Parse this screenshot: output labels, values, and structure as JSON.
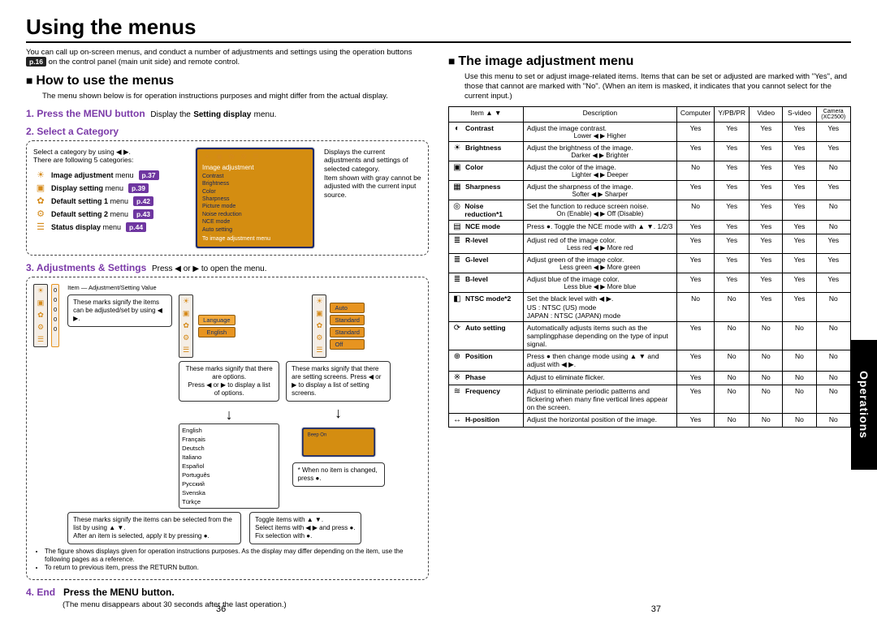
{
  "title": "Using the menus",
  "intro": "You can call up on-screen menus, and conduct a number of adjustments and settings using the operation buttons",
  "intro_tag": "p.16",
  "intro_tail": "on the control panel (main unit side) and remote control.",
  "left": {
    "section": "How to use the menus",
    "section_note": "The menu shown below is for operation instructions purposes and might differ from the actual display.",
    "step1": {
      "num": "1.",
      "label": "Press the MENU button",
      "tail": "Display the",
      "tail_bold": "Setting display",
      "tail_after": "menu."
    },
    "step2": {
      "num": "2.",
      "label": "Select a Category"
    },
    "cat_intro1": "Select a category by using ◀ ▶.",
    "cat_intro2": "There are following 5 categories:",
    "menus": [
      {
        "icon": "☀",
        "bold": "Image adjustment",
        "rest": " menu",
        "tag": "p.37"
      },
      {
        "icon": "▣",
        "bold": "Display setting",
        "rest": " menu",
        "tag": "p.39"
      },
      {
        "icon": "✿",
        "bold": "Default setting 1",
        "rest": " menu",
        "tag": "p.42"
      },
      {
        "icon": "⚙",
        "bold": "Default setting 2",
        "rest": " menu",
        "tag": "p.43"
      },
      {
        "icon": "☰",
        "bold": "Status display",
        "rest": " menu",
        "tag": "p.44"
      }
    ],
    "cat_right_note": "Displays the current adjustments and settings of selected category.\nItem shown with gray cannot be adjusted with the current input source.",
    "step3": {
      "num": "3.",
      "label": "Adjustments & Settings",
      "tail": "Press ◀ or ▶ to open the menu."
    },
    "diagram_labels": {
      "item": "Item",
      "adjval": "Adjustment/Setting Value",
      "left_call": "These marks signify the items can be adjusted/set by using ◀ ▶.",
      "mid_call": "These marks signify that there are options.\nPress ◀ or ▶ to display a list of options.",
      "right_call": "These marks signify that there are setting screens. Press ◀ or ▶ to display a list of setting screens.",
      "bottom_call": "These marks signify the items can be selected from the list by using ▲ ▼.\nAfter an item is selected, apply it by pressing ●.",
      "toggle": "Toggle items with ▲ ▼.\nSelect items with ◀ ▶ and press ●.\nFix selection with ●.",
      "noitem": "* When no item is changed, press ●."
    },
    "screen_labels": {
      "title": "Image adjustment",
      "rows": [
        "Contrast",
        "Brightness",
        "Color",
        "Sharpness",
        "Picture mode",
        "Noise reduction",
        "NCE mode",
        "Auto setting"
      ],
      "footer": "To image adjustment menu"
    },
    "lang_labels": [
      "Language",
      "English",
      "Français",
      "Deutsch",
      "Italiano",
      "Español",
      "Português",
      "Русский",
      "Svenska",
      "Türkçe"
    ],
    "logo_labels": [
      "Auto",
      "Standard",
      "Standard",
      "Off"
    ],
    "beep": "Beep On",
    "notes": [
      "The figure shows displays given for operation instructions purposes. As the display may differ depending on the item, use the following pages as a reference.",
      "To return to previous item, press the RETURN button."
    ],
    "step4": {
      "num": "4.",
      "label": "End",
      "tail_bold": "Press the MENU button.",
      "note": "(The menu disappears about 30 seconds after the last operation.)"
    }
  },
  "right": {
    "section": "The image adjustment menu",
    "intro": "Use this menu to set or adjust image-related items. Items that can be set or adjusted are marked with \"Yes\", and those that cannot are marked with \"No\". (When an item is masked, it indicates that you cannot select for the current input.)",
    "headers": {
      "item": "Item ▲ ▼",
      "desc": "Description",
      "c1": "Computer",
      "c2": "Y/PB/PR",
      "c3": "Video",
      "c4": "S-video",
      "c5": "Camera (XC2500)"
    },
    "rows": [
      {
        "sym": "◐",
        "name": "Contrast",
        "desc": "Adjust the image contrast.",
        "sub": "Lower ◀ ▶ Higher",
        "v": [
          "Yes",
          "Yes",
          "Yes",
          "Yes",
          "Yes"
        ]
      },
      {
        "sym": "☀",
        "name": "Brightness",
        "desc": "Adjust the brightness of the image.",
        "sub": "Darker ◀ ▶ Brighter",
        "v": [
          "Yes",
          "Yes",
          "Yes",
          "Yes",
          "Yes"
        ]
      },
      {
        "sym": "▣",
        "name": "Color",
        "desc": "Adjust the color of the image.",
        "sub": "Lighter ◀ ▶ Deeper",
        "v": [
          "No",
          "Yes",
          "Yes",
          "Yes",
          "No"
        ]
      },
      {
        "sym": "▦",
        "name": "Sharpness",
        "desc": "Adjust the sharpness of the image.",
        "sub": "Softer ◀ ▶ Sharper",
        "v": [
          "Yes",
          "Yes",
          "Yes",
          "Yes",
          "Yes"
        ]
      },
      {
        "sym": "◎",
        "name": "Noise reduction*1",
        "desc": "Set the function to reduce screen noise.",
        "sub": "On (Enable) ◀ ▶ Off (Disable)",
        "v": [
          "No",
          "Yes",
          "Yes",
          "Yes",
          "No"
        ]
      },
      {
        "sym": "▤",
        "name": "NCE mode",
        "desc": "Press ●. Toggle the NCE mode with ▲ ▼. 1/2/3",
        "sub": "",
        "v": [
          "Yes",
          "Yes",
          "Yes",
          "Yes",
          "No"
        ]
      },
      {
        "sym": "≣",
        "name": "R-level",
        "desc": "Adjust red of the image color.",
        "sub": "Less red ◀ ▶ More red",
        "v": [
          "Yes",
          "Yes",
          "Yes",
          "Yes",
          "Yes"
        ]
      },
      {
        "sym": "≣",
        "name": "G-level",
        "desc": "Adjust green of the image color.",
        "sub": "Less green ◀ ▶ More green",
        "v": [
          "Yes",
          "Yes",
          "Yes",
          "Yes",
          "Yes"
        ]
      },
      {
        "sym": "≣",
        "name": "B-level",
        "desc": "Adjust blue of the image color.",
        "sub": "Less blue ◀ ▶ More blue",
        "v": [
          "Yes",
          "Yes",
          "Yes",
          "Yes",
          "Yes"
        ]
      },
      {
        "sym": "◧",
        "name": "NTSC mode*2",
        "desc": "Set the black level with ◀ ▶.\nUS                : NTSC (US) mode\nJAPAN         : NTSC (JAPAN) mode",
        "sub": "",
        "v": [
          "No",
          "No",
          "Yes",
          "Yes",
          "No"
        ]
      },
      {
        "sym": "⟳",
        "name": "Auto setting",
        "desc": "Automatically adjusts items such as the samplingphase depending on the type of input signal.",
        "sub": "",
        "v": [
          "Yes",
          "No",
          "No",
          "No",
          "No"
        ]
      },
      {
        "sym": "⊕",
        "name": "Position",
        "desc": "Press ● then change mode using ▲ ▼ and adjust with ◀ ▶.",
        "sub": "",
        "v": [
          "Yes",
          "No",
          "No",
          "No",
          "No"
        ]
      },
      {
        "sym": "※",
        "name": "Phase",
        "desc": "Adjust to eliminate flicker.",
        "sub": "",
        "v": [
          "Yes",
          "No",
          "No",
          "No",
          "No"
        ]
      },
      {
        "sym": "≋",
        "name": "Frequency",
        "desc": "Adjust to eliminate periodic patterns and flickering when many fine vertical lines appear on the screen.",
        "sub": "",
        "v": [
          "Yes",
          "No",
          "No",
          "No",
          "No"
        ]
      },
      {
        "sym": "↔",
        "name": "H-position",
        "desc": "Adjust the horizontal position of the image.",
        "sub": "",
        "v": [
          "Yes",
          "No",
          "No",
          "No",
          "No"
        ]
      }
    ]
  },
  "sidetab": "Operations",
  "pagenums": {
    "left": "36",
    "right": "37"
  }
}
